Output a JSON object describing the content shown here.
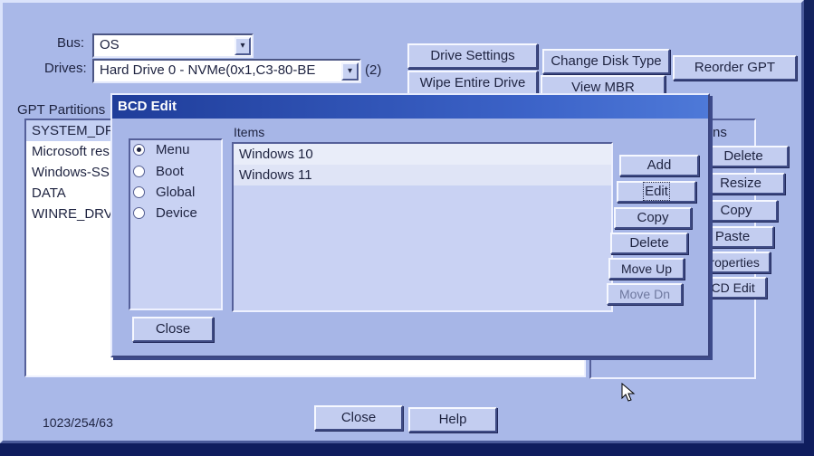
{
  "bus": {
    "label": "Bus:",
    "value": "OS"
  },
  "drives": {
    "label": "Drives:",
    "value": "Hard Drive 0 - NVMe(0x1,C3-80-BE",
    "count": "(2)"
  },
  "toolbar": {
    "drive_settings": "Drive Settings",
    "change_disk_type": "Change Disk Type",
    "reorder_gpt": "Reorder GPT",
    "wipe_entire_drive": "Wipe Entire Drive",
    "view_mbr": "View MBR"
  },
  "partitions": {
    "label": "GPT Partitions",
    "items": [
      "SYSTEM_DF",
      "Microsoft res",
      "Windows-SS",
      "DATA",
      "WINRE_DRV"
    ]
  },
  "right_panel": {
    "label": "ns",
    "buttons": [
      "Delete",
      "Resize",
      "Copy",
      "Paste",
      "Properties",
      "BCD Edit"
    ]
  },
  "geometry": "1023/254/63",
  "footer": {
    "close": "Close",
    "help": "Help"
  },
  "bcd_dialog": {
    "title": "BCD Edit",
    "radios": [
      {
        "label": "Menu",
        "selected": true
      },
      {
        "label": "Boot",
        "selected": false
      },
      {
        "label": "Global",
        "selected": false
      },
      {
        "label": "Device",
        "selected": false
      }
    ],
    "items_label": "Items",
    "items": [
      "Windows 10",
      "Windows 11"
    ],
    "buttons": {
      "add": "Add",
      "edit": "Edit",
      "copy": "Copy",
      "delete": "Delete",
      "move_up": "Move Up",
      "move_down": "Move Dn"
    },
    "close": "Close"
  },
  "colors": {
    "dialog_title": "#2a4db0",
    "window_bg": "#a9b8e8",
    "outer_bg": "#0f1d5e"
  }
}
